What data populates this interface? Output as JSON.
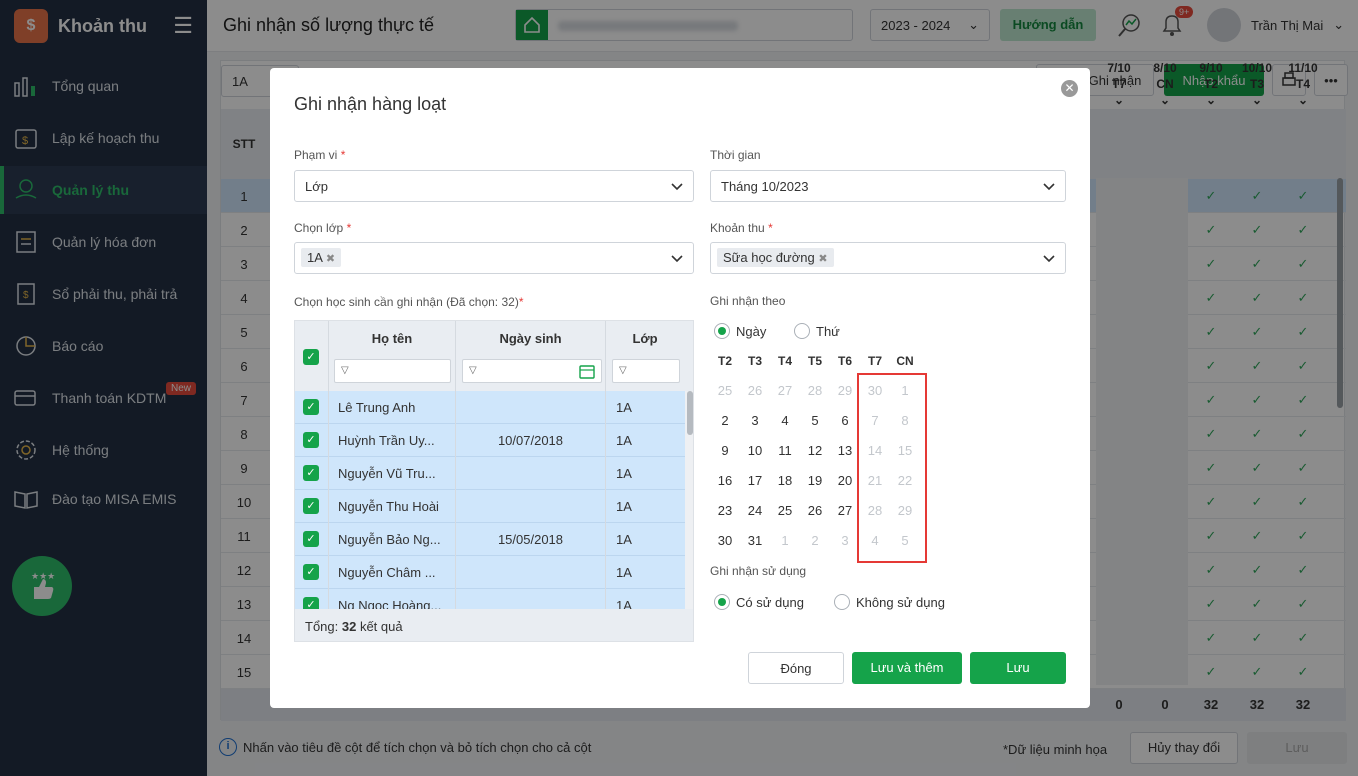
{
  "app": {
    "title": "Khoản thu"
  },
  "sidebar": {
    "items": [
      {
        "label": "Tổng quan",
        "icon": "bar-chart-icon"
      },
      {
        "label": "Lập kế hoạch thu",
        "icon": "calendar-money-icon"
      },
      {
        "label": "Quản lý thu",
        "icon": "money-hand-icon"
      },
      {
        "label": "Quản lý hóa đơn",
        "icon": "invoice-icon"
      },
      {
        "label": "Sổ phải thu, phải trả",
        "icon": "ledger-icon"
      },
      {
        "label": "Báo cáo",
        "icon": "pie-chart-icon"
      },
      {
        "label": "Thanh toán KDTM",
        "icon": "card-payment-icon",
        "badge": "New"
      },
      {
        "label": "Hệ thống",
        "icon": "gear-icon"
      },
      {
        "label": "Đào tạo MISA EMIS",
        "icon": "book-icon"
      }
    ]
  },
  "header": {
    "title": "Ghi nhận số lượng thực tế",
    "year": "2023 - 2024",
    "help": "Hướng dẫn",
    "notif_badge": "9+",
    "user": "Trần Thị Mai"
  },
  "background": {
    "class_value": "1A",
    "btn_ghinhan": "Ghi nhận",
    "btn_import": "Nhập khẩu",
    "stt_header": "STT",
    "rows": [
      "1",
      "2",
      "3",
      "4",
      "5",
      "6",
      "7",
      "8",
      "9",
      "10",
      "11",
      "12",
      "13",
      "14",
      "15"
    ],
    "day_cols": [
      {
        "d": "7/10",
        "w": "T7"
      },
      {
        "d": "8/10",
        "w": "CN"
      },
      {
        "d": "9/10",
        "w": "T2"
      },
      {
        "d": "10/10",
        "w": "T3"
      },
      {
        "d": "11/10",
        "w": "T4"
      }
    ],
    "footer_totals": [
      "0",
      "0",
      "32",
      "32",
      "32"
    ],
    "note": "Nhấn vào tiêu đề cột để tích chọn và bỏ tích chọn cho cả cột",
    "sample": "*Dữ liệu minh họa",
    "btn_cancel": "Hủy thay đổi",
    "btn_save": "Lưu"
  },
  "modal": {
    "title": "Ghi nhận hàng loạt",
    "scope": {
      "label": "Phạm vi",
      "value": "Lớp"
    },
    "time": {
      "label": "Thời gian",
      "value": "Tháng 10/2023"
    },
    "class": {
      "label": "Chọn lớp",
      "tag": "1A"
    },
    "fee": {
      "label": "Khoản thu",
      "tag": "Sữa học đường"
    },
    "students_label": "Chọn học sinh cần ghi nhận (Đã chọn: 32)",
    "table": {
      "headers": [
        "Họ tên",
        "Ngày sinh",
        "Lớp"
      ],
      "rows": [
        {
          "name": "Lê Trung Anh",
          "dob": "",
          "cls": "1A"
        },
        {
          "name": "Huỳnh Trần Uy...",
          "dob": "10/07/2018",
          "cls": "1A"
        },
        {
          "name": "Nguyễn Vũ Tru...",
          "dob": "",
          "cls": "1A"
        },
        {
          "name": "Nguyễn Thu Hoài",
          "dob": "",
          "cls": "1A"
        },
        {
          "name": "Nguyễn Bảo Ng...",
          "dob": "15/05/2018",
          "cls": "1A"
        },
        {
          "name": "Nguyễn Châm ...",
          "dob": "",
          "cls": "1A"
        },
        {
          "name": "Ng Ngọc Hoàng...",
          "dob": "",
          "cls": "1A"
        }
      ],
      "total_prefix": "Tổng: ",
      "total": "32",
      "total_suffix": " kết quả"
    },
    "record_by": {
      "label": "Ghi nhận theo",
      "opt1": "Ngày",
      "opt2": "Thứ"
    },
    "calendar": {
      "headers": [
        "T2",
        "T3",
        "T4",
        "T5",
        "T6",
        "T7",
        "CN"
      ],
      "weeks": [
        [
          "25",
          "26",
          "27",
          "28",
          "29",
          "30",
          "1"
        ],
        [
          "2",
          "3",
          "4",
          "5",
          "6",
          "7",
          "8"
        ],
        [
          "9",
          "10",
          "11",
          "12",
          "13",
          "14",
          "15"
        ],
        [
          "16",
          "17",
          "18",
          "19",
          "20",
          "21",
          "22"
        ],
        [
          "23",
          "24",
          "25",
          "26",
          "27",
          "28",
          "29"
        ],
        [
          "30",
          "31",
          "1",
          "2",
          "3",
          "4",
          "5"
        ]
      ]
    },
    "usage": {
      "label": "Ghi nhận sử dụng",
      "opt1": "Có sử dụng",
      "opt2": "Không sử dụng"
    },
    "buttons": {
      "close": "Đóng",
      "save_add": "Lưu và thêm",
      "save": "Lưu"
    }
  },
  "colors": {
    "accent": "#15a34a",
    "sidebar": "#233044",
    "highlight": "#e53935"
  }
}
